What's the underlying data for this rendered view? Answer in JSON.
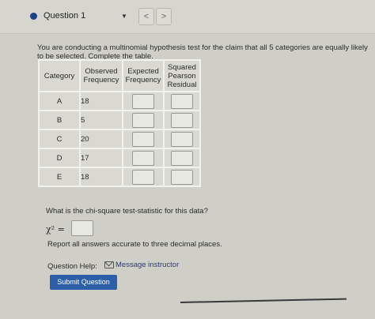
{
  "header": {
    "question_label": "Question 1",
    "caret": "▼",
    "prev": "<",
    "next": ">"
  },
  "prompt": "You are conducting a multinomial hypothesis test for the claim that all 5 categories are equally likely to be selected. Complete the table.",
  "table": {
    "headers": {
      "category": "Category",
      "observed": "Observed Frequency",
      "expected": "Expected Frequency",
      "residual": "Squared Pearson Residual"
    },
    "rows": [
      {
        "category": "A",
        "observed": "18"
      },
      {
        "category": "B",
        "observed": "5"
      },
      {
        "category": "C",
        "observed": "20"
      },
      {
        "category": "D",
        "observed": "17"
      },
      {
        "category": "E",
        "observed": "18"
      }
    ]
  },
  "chi_square": {
    "question": "What is the chi-square test-statistic for this data?",
    "symbol": "χ² ="
  },
  "report_text": "Report all answers accurate to three decimal places.",
  "help": {
    "label": "Question Help:",
    "message_link": "Message instructor"
  },
  "submit_label": "Submit Question",
  "colors": {
    "submit_bg": "#2c5fa8",
    "question_dot": "#1f3f8a"
  }
}
